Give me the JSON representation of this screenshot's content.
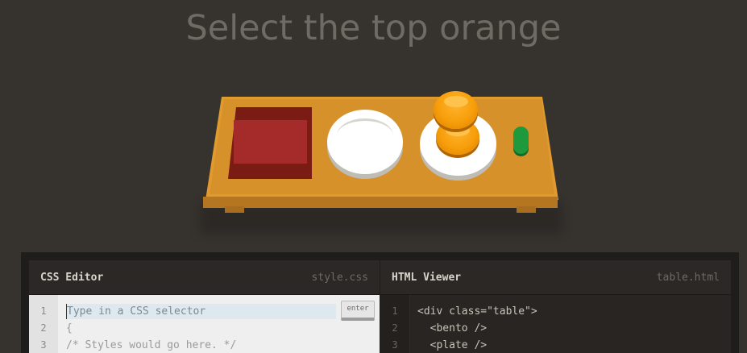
{
  "level": {
    "instruction": "Select the top orange"
  },
  "colors": {
    "background": "#36322e",
    "table": "#e09a2e",
    "bento": "#a52a2a",
    "orange": "#f79e0a",
    "pickle": "#1e9a3c",
    "plate": "#ffffff"
  },
  "scene": {
    "items": [
      "bento",
      "plate",
      "plate-with-two-oranges",
      "pickle"
    ]
  },
  "css_editor": {
    "title": "CSS Editor",
    "file": "style.css",
    "input_placeholder": "Type in a CSS selector",
    "enter_label": "enter",
    "line_numbers": [
      "1",
      "2",
      "3"
    ],
    "lines": [
      "{",
      "/* Styles would go here. */"
    ]
  },
  "html_viewer": {
    "title": "HTML Viewer",
    "file": "table.html",
    "line_numbers": [
      "1",
      "2",
      "3"
    ],
    "lines": [
      "<div class=\"table\">",
      "  <bento />",
      "  <plate />"
    ]
  }
}
